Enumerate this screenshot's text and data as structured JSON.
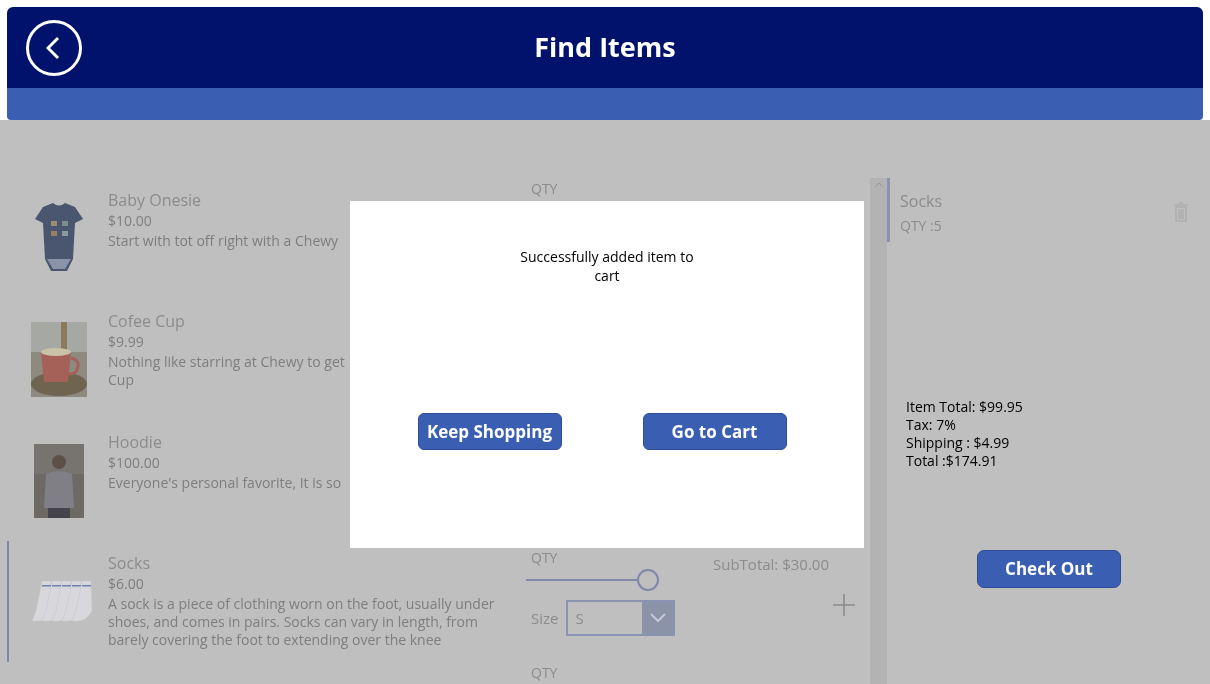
{
  "header": {
    "title": "Find Items"
  },
  "rows": [
    {
      "name": "Baby Onesie",
      "price": "$10.00",
      "description": [
        "Start with tot off right with a Chewy"
      ],
      "qty_label": "QTY",
      "selected": false,
      "image": {
        "kind": "picture"
      }
    },
    {
      "name": "Cofee Cup",
      "price": "$9.99",
      "description": [
        "Nothing like starring at Chewy to get",
        "Cup"
      ],
      "selected": false,
      "image": {
        "kind": "picture"
      }
    },
    {
      "name": "Hoodie",
      "price": "$100.00",
      "description": [
        "Everyone's personal favorite, It is so"
      ],
      "selected": false,
      "image": {
        "kind": "picture"
      }
    },
    {
      "name": "Socks",
      "price": "$6.00",
      "description": [
        "A sock is a piece of clothing worn on the foot, usually under",
        "shoes, and comes in pairs. Socks can vary in length, from",
        "barely covering the foot to extending over the knee"
      ],
      "qty_label": "QTY",
      "qty": {
        "level": 1
      },
      "size_label": "Size",
      "size_value": "S",
      "subtotal": "SubTotal: $30.00",
      "selected": true,
      "image": {
        "kind": "picture"
      }
    },
    {
      "qty_label": "QTY",
      "selected": false
    }
  ],
  "cart": {
    "items": [
      {
        "name": "Socks",
        "qty": "QTY :5",
        "selected": true
      }
    ],
    "totals": [
      "Item Total: $99.95",
      "Tax: 7%",
      "Shipping : $4.99",
      "Total :$174.91"
    ],
    "checkout": "Check Out"
  },
  "dialog": {
    "message": "Successfully added item to cart",
    "buttons": [
      "Keep Shopping",
      "Go to Cart"
    ]
  }
}
